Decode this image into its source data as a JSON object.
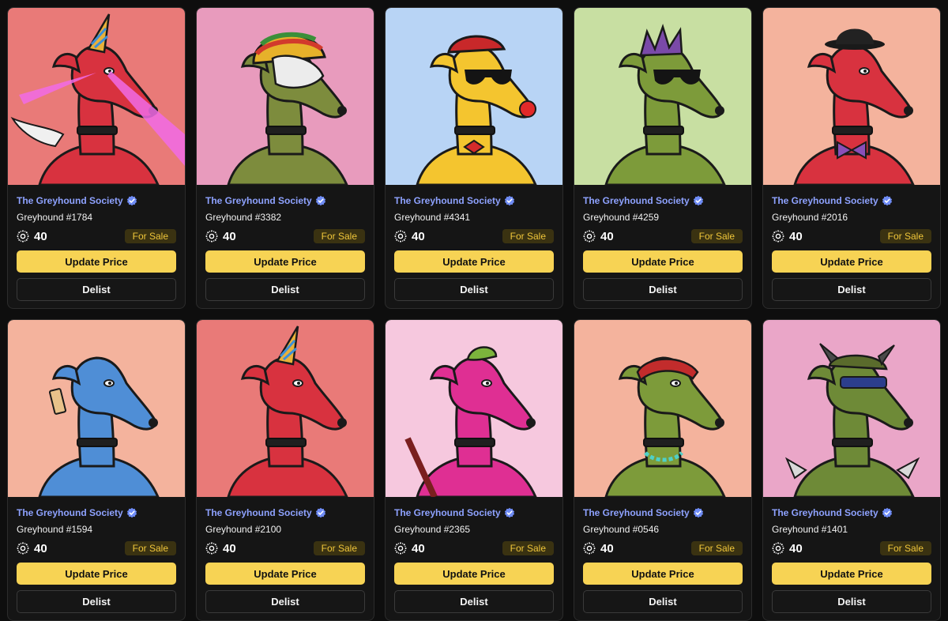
{
  "listings": [
    {
      "collection": "The Greyhound Society",
      "name": "Greyhound #1784",
      "price": "40",
      "status": "For Sale",
      "update_label": "Update Price",
      "delist_label": "Delist",
      "bg_color": "#e97a78",
      "fur_color": "#d8323f",
      "accessory": "unicorn-horn-laser-eyes-wings"
    },
    {
      "collection": "The Greyhound Society",
      "name": "Greyhound #3382",
      "price": "40",
      "status": "For Sale",
      "update_label": "Update Price",
      "delist_label": "Delist",
      "bg_color": "#e89bbd",
      "fur_color": "#7d8c3d",
      "accessory": "rasta-hat-skull-mask"
    },
    {
      "collection": "The Greyhound Society",
      "name": "Greyhound #4341",
      "price": "40",
      "status": "For Sale",
      "update_label": "Update Price",
      "delist_label": "Delist",
      "bg_color": "#b8d4f5",
      "fur_color": "#f4c52f",
      "accessory": "clown-sunglasses"
    },
    {
      "collection": "The Greyhound Society",
      "name": "Greyhound #4259",
      "price": "40",
      "status": "For Sale",
      "update_label": "Update Price",
      "delist_label": "Delist",
      "bg_color": "#c8dfa2",
      "fur_color": "#7d9b3a",
      "accessory": "sunglasses-punk-hair"
    },
    {
      "collection": "The Greyhound Society",
      "name": "Greyhound #2016",
      "price": "40",
      "status": "For Sale",
      "update_label": "Update Price",
      "delist_label": "Delist",
      "bg_color": "#f4b39d",
      "fur_color": "#d8323f",
      "accessory": "bowler-hat-bowtie"
    },
    {
      "collection": "The Greyhound Society",
      "name": "Greyhound #1594",
      "price": "40",
      "status": "For Sale",
      "update_label": "Update Price",
      "delist_label": "Delist",
      "bg_color": "#f4b39d",
      "fur_color": "#4f8ed6",
      "accessory": "tgs-tag"
    },
    {
      "collection": "The Greyhound Society",
      "name": "Greyhound #2100",
      "price": "40",
      "status": "For Sale",
      "update_label": "Update Price",
      "delist_label": "Delist",
      "bg_color": "#e97a78",
      "fur_color": "#d8323f",
      "accessory": "unicorn-horn"
    },
    {
      "collection": "The Greyhound Society",
      "name": "Greyhound #2365",
      "price": "40",
      "status": "For Sale",
      "update_label": "Update Price",
      "delist_label": "Delist",
      "bg_color": "#f6c8de",
      "fur_color": "#df2f93",
      "accessory": "lizard-katana"
    },
    {
      "collection": "The Greyhound Society",
      "name": "Greyhound #0546",
      "price": "40",
      "status": "For Sale",
      "update_label": "Update Price",
      "delist_label": "Delist",
      "bg_color": "#f4b39d",
      "fur_color": "#7d9b3a",
      "accessory": "bandana-chain"
    },
    {
      "collection": "The Greyhound Society",
      "name": "Greyhound #1401",
      "price": "40",
      "status": "For Sale",
      "update_label": "Update Price",
      "delist_label": "Delist",
      "bg_color": "#eaa6c8",
      "fur_color": "#6e8a37",
      "accessory": "horned-helmet-spikes"
    }
  ],
  "icons": {
    "verified": "verified-badge-icon",
    "currency": "cardano-icon"
  },
  "colors": {
    "accent_yellow": "#f7d354",
    "link_blue": "#8ea2ff",
    "badge_text": "#f0c63a",
    "page_bg": "#0e0e0e"
  }
}
